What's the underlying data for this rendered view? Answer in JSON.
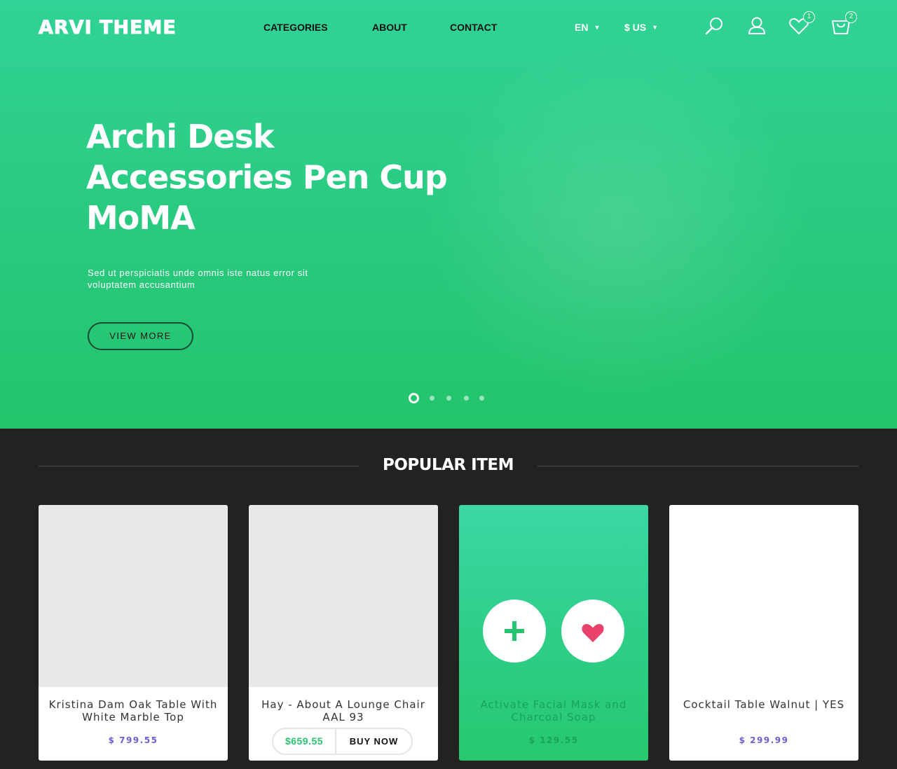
{
  "brand": {
    "logo": "ARVI THEME"
  },
  "nav": [
    {
      "label": "CATEGORIES"
    },
    {
      "label": "ABOUT"
    },
    {
      "label": "CONTACT"
    }
  ],
  "selectors": {
    "language": "EN",
    "currency": "$ US"
  },
  "header_icons": {
    "search": "search-icon",
    "account": "user-icon",
    "wishlist": "heart-icon",
    "cart": "bag-icon",
    "wishlist_count": "1",
    "cart_count": "2"
  },
  "hero": {
    "title_lines": [
      "Archi Desk",
      "Accessories Pen Cup",
      "MoMA"
    ],
    "subtitle": "Sed ut perspiciatis unde omnis iste natus error sit voluptatem accusantium",
    "cta": "VIEW MORE",
    "slides_total": 5,
    "active_slide": 1
  },
  "popular": {
    "title": "POPULAR ITEM",
    "items": [
      {
        "name": "Kristina Dam Oak Table With White Marble Top",
        "price": "$ 799.55"
      },
      {
        "name": "Hay - About A Lounge Chair AAL 93",
        "price": "$659.55",
        "action": "BUY NOW"
      },
      {
        "name": "Activate Facial Mask and Charcoal Soap",
        "price": "$ 129.55",
        "actions": [
          "plus-icon",
          "heart-icon"
        ]
      },
      {
        "name": "Cocktail Table Walnut | YES",
        "price": "$ 299.99"
      }
    ]
  },
  "colors": {
    "accent_green": "#2bcf87",
    "price_purple": "#6b5fd6",
    "heart_pink": "#e8416c",
    "dark_bg": "#222222"
  }
}
